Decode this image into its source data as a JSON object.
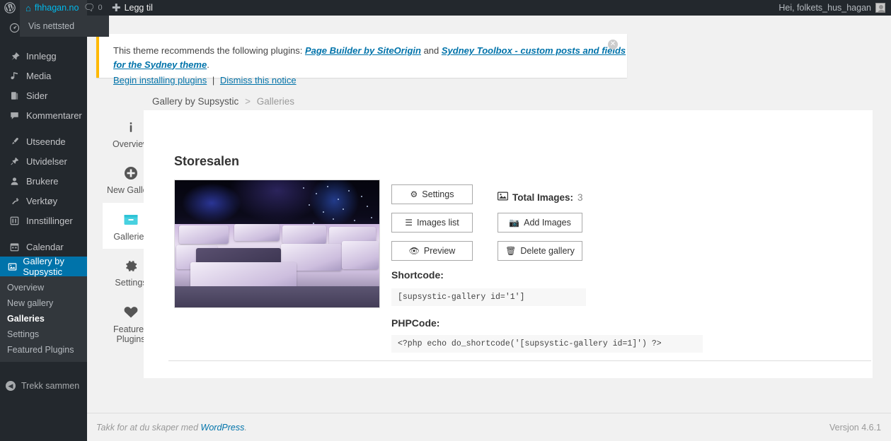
{
  "adminbar": {
    "wp_logo_icon": "wordpress-logo-icon",
    "site_name": "fhhagan.no",
    "site_icon": "home-icon",
    "comments_icon": "comment-bubble-icon",
    "comments_count": "0",
    "new_label": "Legg til",
    "new_icon": "plus-icon",
    "greeting": "Hei, folkets_hus_hagan",
    "avatar_icon": "user-avatar-icon",
    "dropdown_item": "Vis nettsted"
  },
  "sidebar": {
    "items": [
      {
        "label": "Innlegg",
        "icon": "pin-icon"
      },
      {
        "label": "Media",
        "icon": "media-icon"
      },
      {
        "label": "Sider",
        "icon": "pages-icon"
      },
      {
        "label": "Kommentarer",
        "icon": "comment-icon"
      },
      {
        "label": "Utseende",
        "icon": "appearance-brush-icon"
      },
      {
        "label": "Utvidelser",
        "icon": "plugin-plug-icon"
      },
      {
        "label": "Brukere",
        "icon": "users-icon"
      },
      {
        "label": "Verktøy",
        "icon": "tools-wrench-icon"
      },
      {
        "label": "Innstillinger",
        "icon": "settings-sliders-icon"
      },
      {
        "label": "Calendar",
        "icon": "calendar-icon"
      },
      {
        "label": "Gallery by Supsystic",
        "icon": "gallery-icon"
      }
    ],
    "submenu": [
      {
        "label": "Overview"
      },
      {
        "label": "New gallery"
      },
      {
        "label": "Galleries"
      },
      {
        "label": "Settings"
      },
      {
        "label": "Featured Plugins"
      }
    ],
    "collapse_label": "Trekk sammen",
    "collapse_icon": "arrow-left-circle-icon"
  },
  "notice": {
    "intro": "This theme recommends the following plugins: ",
    "plugin_1": "Page Builder by SiteOrigin",
    "conjunction": " and ",
    "plugin_2": "Sydney Toolbox - custom posts and fields for the Sydney theme",
    "period": ".",
    "install_link": "Begin installing plugins",
    "separator": "|",
    "dismiss_link": "Dismiss this notice",
    "close_icon": "close-circle-icon"
  },
  "breadcrumb": {
    "root": "Gallery by Supsystic",
    "separator": ">",
    "current": "Galleries"
  },
  "tabs": [
    {
      "label": "Overview",
      "icon": "info-icon"
    },
    {
      "label": "New Gallery",
      "icon": "plus-circle-icon"
    },
    {
      "label": "Galleries",
      "icon": "gallery-box-icon"
    },
    {
      "label": "Settings",
      "icon": "gear-icon"
    },
    {
      "label": "Featured Plugins",
      "icon": "heart-icon"
    }
  ],
  "gallery": {
    "title": "Storesalen",
    "thumbnail_alt": "banquet-hall-photo",
    "buttons": {
      "settings": "Settings",
      "settings_icon": "gear-icon",
      "images_list": "Images list",
      "images_list_icon": "list-icon",
      "preview": "Preview",
      "preview_icon": "eye-icon",
      "add_images": "Add Images",
      "add_images_icon": "camera-icon",
      "delete_gallery": "Delete gallery",
      "delete_gallery_icon": "trash-icon"
    },
    "total_images_icon": "image-icon",
    "total_images_label": "Total Images:",
    "total_images_count": "3",
    "shortcode_label": "Shortcode:",
    "shortcode_value": "[supsystic-gallery id='1']",
    "phpcode_label": "PHPCode:",
    "phpcode_value": "<?php echo do_shortcode('[supsystic-gallery id=1]') ?>"
  },
  "footer": {
    "thanks_prefix": "Takk for at du skaper med ",
    "wordpress_link": "WordPress",
    "thanks_suffix": ".",
    "version": "Versjon 4.6.1"
  },
  "colors": {
    "admin_dark": "#23282d",
    "admin_dark_alt": "#32373c",
    "accent_blue": "#0073aa",
    "link_blue": "#00b9eb",
    "notice_yellow": "#ffb900",
    "tab_active_cyan": "#48d1e0"
  }
}
